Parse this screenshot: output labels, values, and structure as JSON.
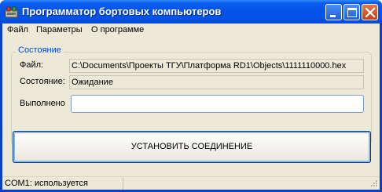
{
  "window": {
    "title": "Программатор бортовых компьютеров",
    "minimize_icon": "minimize-icon",
    "maximize_icon": "maximize-icon",
    "close_icon": "close-icon",
    "app_icon": "app-icon"
  },
  "menu": {
    "items": [
      {
        "label": "Файл"
      },
      {
        "label": "Параметры"
      },
      {
        "label": "О программе"
      }
    ]
  },
  "group": {
    "title": "Состояние",
    "file_label": "Файл:",
    "file_value": "C:\\Documents\\Проекты ТГУ\\Платформа RD1\\Objects\\1111110000.hex",
    "state_label": "Состояние:",
    "state_value": "Ожидание",
    "progress_label": "Выполнено",
    "progress_value": 0
  },
  "actions": {
    "connect_label": "УСТАНОВИТЬ СОЕДИНЕНИЕ"
  },
  "status": {
    "text": "COM1: используется"
  },
  "colors": {
    "titlebar": "#0553e6",
    "group_title": "#0046d5",
    "face": "#ece9d8"
  }
}
